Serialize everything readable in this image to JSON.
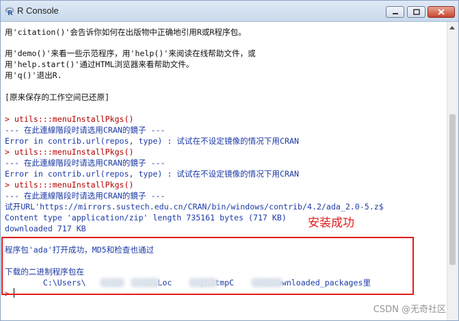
{
  "window": {
    "title": "R Console"
  },
  "console": {
    "lines": [
      "用'citation()'会告诉你如何在出版物中正确地引用R或R程序包。",
      "用'demo()'来看一些示范程序，用'help()'来阅读在线帮助文件，或",
      "用'help.start()'通过HTML浏览器来看帮助文件。",
      "用'q()'退出R.",
      "[原来保存的工作空间已还原]",
      "> utils:::menuInstallPkgs()",
      "--- 在此連線階段时请选用CRAN的鏡子 ---",
      "Error in contrib.url(repos, type) : 试试在不设定镜像的情况下用CRAN",
      "> utils:::menuInstallPkgs()",
      "--- 在此連線階段时请选用CRAN的鏡子 ---",
      "Error in contrib.url(repos, type) : 试试在不设定镜像的情况下用CRAN",
      "> utils:::menuInstallPkgs()",
      "--- 在此連線階段时请选用CRAN的鏡子 ---",
      "试开URL'https://mirrors.sustech.edu.cn/CRAN/bin/windows/contrib/4.2/ada_2.0-5.z$",
      "Content type 'application/zip' length 735161 bytes (717 KB)",
      "downloaded 717 KB",
      "程序包'ada'打开成功，MD5和检查也通过",
      "下载的二进制程序包在",
      "        C:\\Users\\      \\      a\\Loc      p\\RtmpC      X\\downloaded_packages里",
      ">"
    ]
  },
  "annotation": {
    "label": "安装成功",
    "color": "#e31b1b"
  },
  "watermark": "CSDN @无奇社区",
  "colors": {
    "prompt_red": "#b40000",
    "output_blue": "#1c3aa5",
    "annotation_red": "#e31b1b"
  }
}
